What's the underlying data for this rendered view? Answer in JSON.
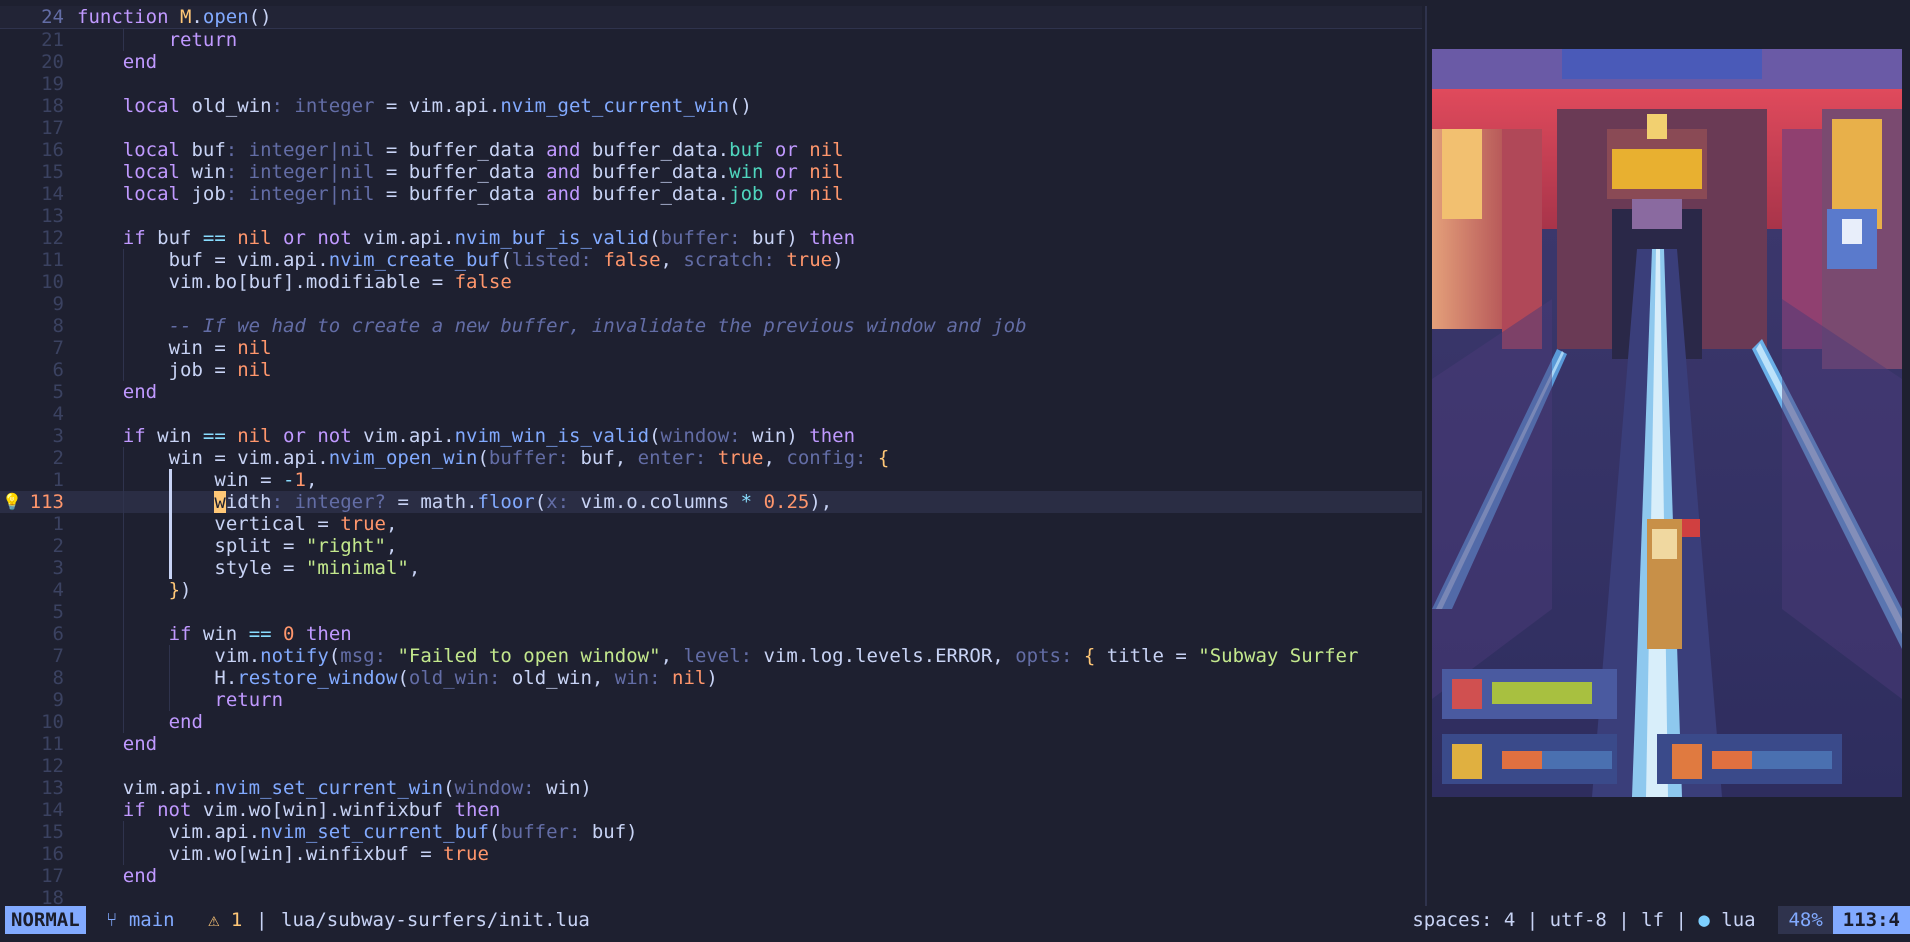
{
  "editor": {
    "lines": [
      {
        "num": "24",
        "sticky": true,
        "indent": 0,
        "tokens": [
          [
            "kw",
            "function"
          ],
          [
            "txt",
            " "
          ],
          [
            "mod",
            "M"
          ],
          [
            "txt",
            "."
          ],
          [
            "fn",
            "open"
          ],
          [
            "txt",
            "()"
          ]
        ]
      },
      {
        "num": "21",
        "indent": 2,
        "tokens": [
          [
            "kw",
            "return"
          ]
        ]
      },
      {
        "num": "20",
        "indent": 1,
        "tokens": [
          [
            "kw",
            "end"
          ]
        ]
      },
      {
        "num": "19",
        "indent": 1,
        "tokens": []
      },
      {
        "num": "18",
        "indent": 1,
        "tokens": [
          [
            "kw",
            "local"
          ],
          [
            "txt",
            " old_win"
          ],
          [
            "type",
            ": integer"
          ],
          [
            "txt",
            " = vim.api."
          ],
          [
            "fn",
            "nvim_get_current_win"
          ],
          [
            "txt",
            "()"
          ]
        ]
      },
      {
        "num": "17",
        "indent": 1,
        "tokens": []
      },
      {
        "num": "16",
        "indent": 1,
        "tokens": [
          [
            "kw",
            "local"
          ],
          [
            "txt",
            " buf"
          ],
          [
            "type",
            ": integer|nil"
          ],
          [
            "txt",
            " = buffer_data "
          ],
          [
            "kw",
            "and"
          ],
          [
            "txt",
            " buffer_data."
          ],
          [
            "fld",
            "buf"
          ],
          [
            "txt",
            " "
          ],
          [
            "kw",
            "or"
          ],
          [
            "txt",
            " "
          ],
          [
            "const",
            "nil"
          ]
        ]
      },
      {
        "num": "15",
        "indent": 1,
        "tokens": [
          [
            "kw",
            "local"
          ],
          [
            "txt",
            " win"
          ],
          [
            "type",
            ": integer|nil"
          ],
          [
            "txt",
            " = buffer_data "
          ],
          [
            "kw",
            "and"
          ],
          [
            "txt",
            " buffer_data."
          ],
          [
            "fld",
            "win"
          ],
          [
            "txt",
            " "
          ],
          [
            "kw",
            "or"
          ],
          [
            "txt",
            " "
          ],
          [
            "const",
            "nil"
          ]
        ]
      },
      {
        "num": "14",
        "indent": 1,
        "tokens": [
          [
            "kw",
            "local"
          ],
          [
            "txt",
            " job"
          ],
          [
            "type",
            ": integer|nil"
          ],
          [
            "txt",
            " = buffer_data "
          ],
          [
            "kw",
            "and"
          ],
          [
            "txt",
            " buffer_data."
          ],
          [
            "fld",
            "job"
          ],
          [
            "txt",
            " "
          ],
          [
            "kw",
            "or"
          ],
          [
            "txt",
            " "
          ],
          [
            "const",
            "nil"
          ]
        ]
      },
      {
        "num": "13",
        "indent": 1,
        "tokens": []
      },
      {
        "num": "12",
        "indent": 1,
        "tokens": [
          [
            "kw",
            "if"
          ],
          [
            "txt",
            " buf "
          ],
          [
            "op",
            "=="
          ],
          [
            "txt",
            " "
          ],
          [
            "const",
            "nil"
          ],
          [
            "txt",
            " "
          ],
          [
            "kw",
            "or not"
          ],
          [
            "txt",
            " vim.api."
          ],
          [
            "fn",
            "nvim_buf_is_valid"
          ],
          [
            "txt",
            "("
          ],
          [
            "hint",
            "buffer: "
          ],
          [
            "txt",
            "buf) "
          ],
          [
            "kw",
            "then"
          ]
        ]
      },
      {
        "num": "11",
        "indent": 2,
        "tokens": [
          [
            "txt",
            "buf = vim.api."
          ],
          [
            "fn",
            "nvim_create_buf"
          ],
          [
            "txt",
            "("
          ],
          [
            "hint",
            "listed: "
          ],
          [
            "const",
            "false"
          ],
          [
            "txt",
            ", "
          ],
          [
            "hint",
            "scratch: "
          ],
          [
            "const",
            "true"
          ],
          [
            "txt",
            ")"
          ]
        ]
      },
      {
        "num": "10",
        "indent": 2,
        "tokens": [
          [
            "txt",
            "vim.bo[buf]."
          ],
          [
            "txt",
            "modifiable = "
          ],
          [
            "const",
            "false"
          ]
        ]
      },
      {
        "num": "9",
        "indent": 2,
        "tokens": []
      },
      {
        "num": "8",
        "indent": 2,
        "tokens": [
          [
            "com",
            "-- If we had to create a new buffer, invalidate the previous window and job"
          ]
        ]
      },
      {
        "num": "7",
        "indent": 2,
        "tokens": [
          [
            "txt",
            "win = "
          ],
          [
            "const",
            "nil"
          ]
        ]
      },
      {
        "num": "6",
        "indent": 2,
        "tokens": [
          [
            "txt",
            "job = "
          ],
          [
            "const",
            "nil"
          ]
        ]
      },
      {
        "num": "5",
        "indent": 1,
        "tokens": [
          [
            "kw",
            "end"
          ]
        ]
      },
      {
        "num": "4",
        "indent": 1,
        "tokens": []
      },
      {
        "num": "3",
        "indent": 1,
        "tokens": [
          [
            "kw",
            "if"
          ],
          [
            "txt",
            " win "
          ],
          [
            "op",
            "=="
          ],
          [
            "txt",
            " "
          ],
          [
            "const",
            "nil"
          ],
          [
            "txt",
            " "
          ],
          [
            "kw",
            "or not"
          ],
          [
            "txt",
            " vim.api."
          ],
          [
            "fn",
            "nvim_win_is_valid"
          ],
          [
            "txt",
            "("
          ],
          [
            "hint",
            "window: "
          ],
          [
            "txt",
            "win) "
          ],
          [
            "kw",
            "then"
          ]
        ]
      },
      {
        "num": "2",
        "indent": 2,
        "tokens": [
          [
            "txt",
            "win = vim.api."
          ],
          [
            "fn",
            "nvim_open_win"
          ],
          [
            "txt",
            "("
          ],
          [
            "hint",
            "buffer: "
          ],
          [
            "txt",
            "buf, "
          ],
          [
            "hint",
            "enter: "
          ],
          [
            "const",
            "true"
          ],
          [
            "txt",
            ", "
          ],
          [
            "hint",
            "config: "
          ],
          [
            "br",
            "{"
          ]
        ]
      },
      {
        "num": "1",
        "indent": 3,
        "active": true,
        "tokens": [
          [
            "txt",
            "win = "
          ],
          [
            "op",
            "-"
          ],
          [
            "num",
            "1"
          ],
          [
            "txt",
            ","
          ]
        ]
      },
      {
        "num": "113",
        "indent": 3,
        "active": true,
        "current": true,
        "sign": "💡",
        "tokens": [
          [
            "cursor",
            "w"
          ],
          [
            "txt",
            "idth"
          ],
          [
            "type",
            ": integer?"
          ],
          [
            "txt",
            " = math."
          ],
          [
            "fn",
            "floor"
          ],
          [
            "txt",
            "("
          ],
          [
            "hint",
            "x: "
          ],
          [
            "txt",
            "vim.o.columns "
          ],
          [
            "op",
            "*"
          ],
          [
            "txt",
            " "
          ],
          [
            "num",
            "0.25"
          ],
          [
            "txt",
            "),"
          ]
        ]
      },
      {
        "num": "1",
        "indent": 3,
        "active": true,
        "tokens": [
          [
            "txt",
            "vertical = "
          ],
          [
            "const",
            "true"
          ],
          [
            "txt",
            ","
          ]
        ]
      },
      {
        "num": "2",
        "indent": 3,
        "active": true,
        "tokens": [
          [
            "txt",
            "split = "
          ],
          [
            "str",
            "\"right\""
          ],
          [
            "txt",
            ","
          ]
        ]
      },
      {
        "num": "3",
        "indent": 3,
        "active": true,
        "tokens": [
          [
            "txt",
            "style = "
          ],
          [
            "str",
            "\"minimal\""
          ],
          [
            "txt",
            ","
          ]
        ]
      },
      {
        "num": "4",
        "indent": 2,
        "tokens": [
          [
            "br",
            "}"
          ],
          [
            "txt",
            ")"
          ]
        ]
      },
      {
        "num": "5",
        "indent": 2,
        "tokens": []
      },
      {
        "num": "6",
        "indent": 2,
        "tokens": [
          [
            "kw",
            "if"
          ],
          [
            "txt",
            " win "
          ],
          [
            "op",
            "=="
          ],
          [
            "txt",
            " "
          ],
          [
            "num",
            "0"
          ],
          [
            "txt",
            " "
          ],
          [
            "kw",
            "then"
          ]
        ]
      },
      {
        "num": "7",
        "indent": 3,
        "tokens": [
          [
            "txt",
            "vim."
          ],
          [
            "fn",
            "notify"
          ],
          [
            "txt",
            "("
          ],
          [
            "hint",
            "msg: "
          ],
          [
            "str",
            "\"Failed to open window\""
          ],
          [
            "txt",
            ", "
          ],
          [
            "hint",
            "level: "
          ],
          [
            "txt",
            "vim.log.levels.ERROR, "
          ],
          [
            "hint",
            "opts: "
          ],
          [
            "br",
            "{"
          ],
          [
            "txt",
            " title = "
          ],
          [
            "str",
            "\"Subway Surfer"
          ]
        ]
      },
      {
        "num": "8",
        "indent": 3,
        "tokens": [
          [
            "txt",
            "H."
          ],
          [
            "fn",
            "restore_window"
          ],
          [
            "txt",
            "("
          ],
          [
            "hint",
            "old_win: "
          ],
          [
            "txt",
            "old_win, "
          ],
          [
            "hint",
            "win: "
          ],
          [
            "const",
            "nil"
          ],
          [
            "txt",
            ")"
          ]
        ]
      },
      {
        "num": "9",
        "indent": 3,
        "tokens": [
          [
            "kw",
            "return"
          ]
        ]
      },
      {
        "num": "10",
        "indent": 2,
        "tokens": [
          [
            "kw",
            "end"
          ]
        ]
      },
      {
        "num": "11",
        "indent": 1,
        "tokens": [
          [
            "kw",
            "end"
          ]
        ]
      },
      {
        "num": "12",
        "indent": 1,
        "tokens": []
      },
      {
        "num": "13",
        "indent": 1,
        "tokens": [
          [
            "txt",
            "vim.api."
          ],
          [
            "fn",
            "nvim_set_current_win"
          ],
          [
            "txt",
            "("
          ],
          [
            "hint",
            "window: "
          ],
          [
            "txt",
            "win)"
          ]
        ]
      },
      {
        "num": "14",
        "indent": 1,
        "tokens": [
          [
            "kw",
            "if not"
          ],
          [
            "txt",
            " vim.wo[win].winfixbuf "
          ],
          [
            "kw",
            "then"
          ]
        ]
      },
      {
        "num": "15",
        "indent": 2,
        "tokens": [
          [
            "txt",
            "vim.api."
          ],
          [
            "fn",
            "nvim_set_current_buf"
          ],
          [
            "txt",
            "("
          ],
          [
            "hint",
            "buffer: "
          ],
          [
            "txt",
            "buf)"
          ]
        ]
      },
      {
        "num": "16",
        "indent": 2,
        "tokens": [
          [
            "txt",
            "vim.wo[win].winfixbuf = "
          ],
          [
            "const",
            "true"
          ]
        ]
      },
      {
        "num": "17",
        "indent": 1,
        "tokens": [
          [
            "kw",
            "end"
          ]
        ]
      },
      {
        "num": "18",
        "indent": 1,
        "tokens": []
      }
    ]
  },
  "statusline": {
    "mode": "NORMAL",
    "branch_icon": "⑂",
    "branch": "main",
    "diag_icon": "⚠",
    "diag_count": "1",
    "sep": "|",
    "file": "lua/subway-surfers/init.lua",
    "right": "spaces: 4 | utf-8 | lf | ",
    "ft_icon": "●",
    "filetype": "lua",
    "percent": "48%",
    "position": "113:4"
  },
  "colors": {
    "background": "#1e2030",
    "accent": "#82aaff",
    "cursor": "#ffc777"
  },
  "game_panel": {
    "icon": "subway-surfers-game-icon"
  }
}
